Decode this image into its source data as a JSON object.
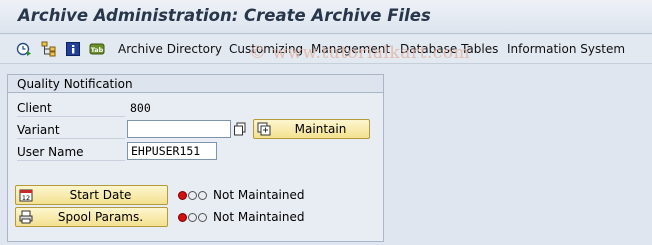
{
  "title": "Archive Administration: Create Archive Files",
  "toolbar": {
    "icons": [
      "execute-clock-icon",
      "structure-tree-icon",
      "info-icon",
      "tab-icon"
    ],
    "menus": [
      "Archive Directory",
      "Customizing",
      "Management",
      "Database Tables",
      "Information System"
    ]
  },
  "watermark": "© www.tutorialkart.com",
  "group": {
    "heading": "Quality Notification",
    "client_label": "Client",
    "client_value": "800",
    "variant_label": "Variant",
    "variant_value": "",
    "maintain_button": "Maintain",
    "username_label": "User Name",
    "username_value": "EHPUSER151",
    "start_date_button": "Start Date",
    "start_date_status": "Not Maintained",
    "spool_button": "Spool Params.",
    "spool_status": "Not Maintained"
  },
  "colors": {
    "lamp_red": "#d60e0e",
    "button_fill": "#f3e18f",
    "title_text": "#27364a"
  }
}
